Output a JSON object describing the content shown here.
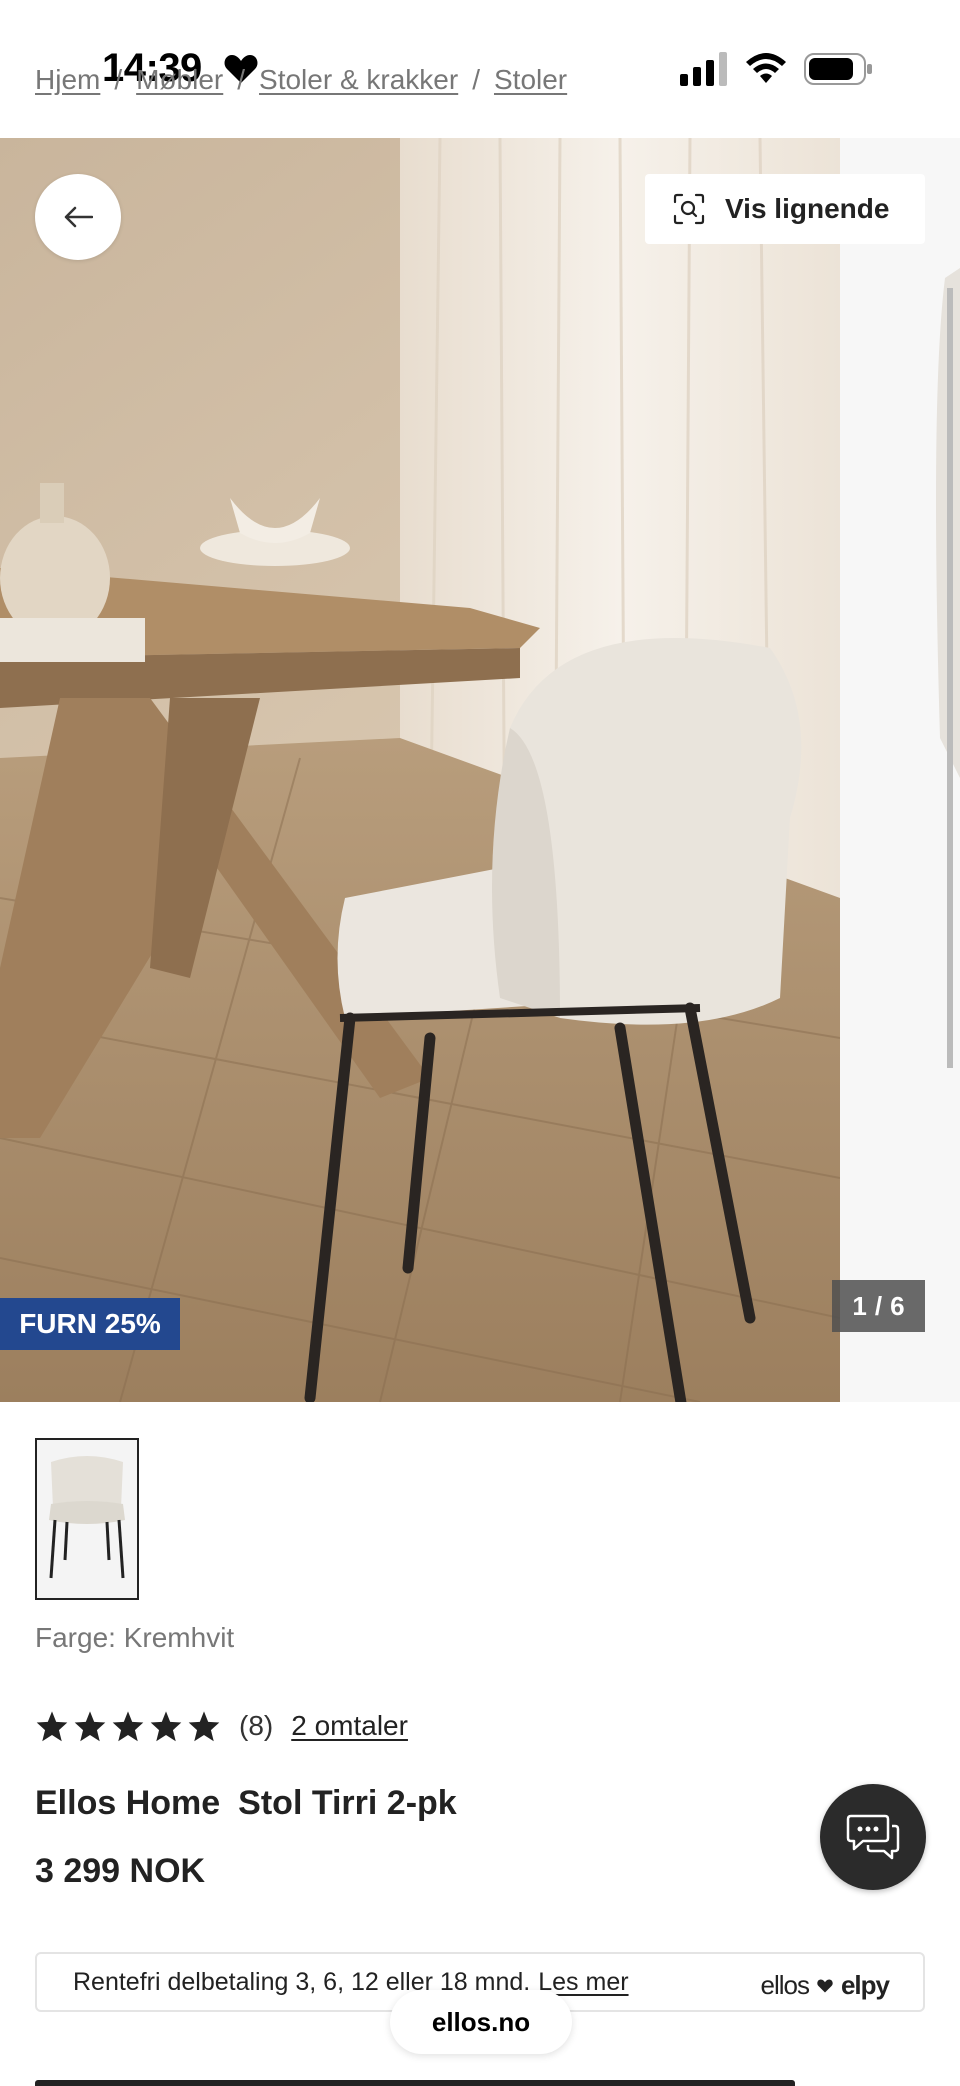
{
  "status_bar": {
    "time": "14:39"
  },
  "breadcrumb": [
    {
      "label": "Hjem"
    },
    {
      "label": "Møbler"
    },
    {
      "label": "Stoler & krakker"
    },
    {
      "label": "Stoler"
    }
  ],
  "breadcrumb_separator": "/",
  "gallery": {
    "similar_label": "Vis lignende",
    "promo_badge": "FURN 25%",
    "current_index": "1",
    "counter_separator": "/",
    "total": "6"
  },
  "product": {
    "color_label": "Farge:",
    "color_value": "Kremhvit",
    "rating_stars": 5,
    "rating_count": "(8)",
    "reviews_link": "2 omtaler",
    "brand": "Ellos Home",
    "name": "Stol Tirri 2-pk",
    "price": "3 299 NOK"
  },
  "installment": {
    "text": "Rentefri delbetaling 3, 6, 12 eller 18 mnd.",
    "link": "Les mer",
    "partner_left": "ellos",
    "partner_right": "elpy"
  },
  "url": "ellos.no",
  "colors": {
    "promo_blue": "#23488f",
    "dark": "#222222",
    "muted": "#777777",
    "chat_bg": "#2b2b2b"
  }
}
